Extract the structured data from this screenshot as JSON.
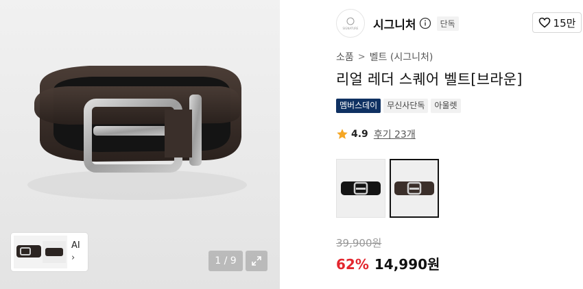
{
  "gallery": {
    "main_image_icon": "belt-photo",
    "thumbnail_label": "AI",
    "thumbnail_chevron": "›",
    "counter": "1 / 9",
    "expand_icon": "expand-icon"
  },
  "brand": {
    "name": "시그니처",
    "logo_text": "SIGNATURE",
    "tag": "단독",
    "info_icon": "info-icon"
  },
  "like": {
    "icon": "heart-icon",
    "count": "15만"
  },
  "breadcrumb": [
    "소품",
    "벨트 (시그니처)"
  ],
  "product": {
    "title": "리얼 레더 스퀘어 벨트[브라운]",
    "badges": [
      "멤버스데이",
      "무신사단독",
      "아울렛"
    ]
  },
  "rating": {
    "icon": "star-icon",
    "score": "4.9",
    "reviews": "후기 23개"
  },
  "options": {
    "items": [
      "option-black-belt",
      "option-brown-belt"
    ],
    "selected_index": 1
  },
  "pricing": {
    "original": "39,900원",
    "discount": "62%",
    "sale": "14,990원"
  },
  "colors": {
    "member_badge": "#0f3162",
    "discount": "#e3262e",
    "star": "#f5a623"
  }
}
